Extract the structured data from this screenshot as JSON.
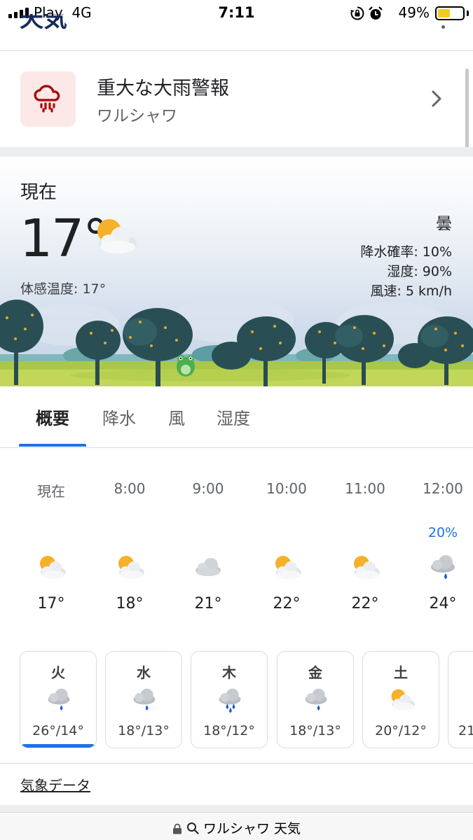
{
  "status_bar": {
    "carrier": "Play",
    "network": "4G",
    "time": "7:11",
    "battery_percent": "49%",
    "battery_level": 0.49,
    "battery_color": "#f5cc1c",
    "icons": [
      "rotation-lock-icon",
      "alarm-icon"
    ]
  },
  "header": {
    "partial_title": "天気"
  },
  "alert": {
    "title": "重大な大雨警報",
    "location": "ワルシャワ",
    "icon": "heavy-rain-icon",
    "icon_color": "#a50e0e",
    "icon_bg": "#fce8e6"
  },
  "current": {
    "label": "現在",
    "temp": "17°",
    "icon": "partly-cloudy-icon",
    "feels_like": "体感温度: 17°",
    "condition": "曇",
    "precip": "降水確率: 10%",
    "humidity": "湿度: 90%",
    "wind": "風速: 5 km/h"
  },
  "tabs": [
    {
      "label": "概要",
      "active": true
    },
    {
      "label": "降水",
      "active": false
    },
    {
      "label": "風",
      "active": false
    },
    {
      "label": "湿度",
      "active": false
    }
  ],
  "hourly": [
    {
      "time": "現在",
      "precip": "",
      "icon": "partly-cloudy-icon",
      "temp": "17°"
    },
    {
      "time": "8:00",
      "precip": "",
      "icon": "partly-cloudy-icon",
      "temp": "18°"
    },
    {
      "time": "9:00",
      "precip": "",
      "icon": "cloudy-icon",
      "temp": "21°"
    },
    {
      "time": "10:00",
      "precip": "",
      "icon": "partly-cloudy-icon",
      "temp": "22°"
    },
    {
      "time": "11:00",
      "precip": "",
      "icon": "partly-cloudy-icon",
      "temp": "22°"
    },
    {
      "time": "12:00",
      "precip": "20%",
      "icon": "rain-icon",
      "temp": "24°"
    }
  ],
  "daily": [
    {
      "day": "火",
      "icon": "rain-icon",
      "temps": "26°/14°",
      "selected": true
    },
    {
      "day": "水",
      "icon": "rain-icon",
      "temps": "18°/13°",
      "selected": false
    },
    {
      "day": "木",
      "icon": "heavy-rain-icon",
      "temps": "18°/12°",
      "selected": false
    },
    {
      "day": "金",
      "icon": "rain-icon",
      "temps": "18°/13°",
      "selected": false
    },
    {
      "day": "土",
      "icon": "partly-cloudy-icon",
      "temps": "20°/12°",
      "selected": false
    },
    {
      "day": "",
      "icon": "",
      "temps": "21",
      "selected": false
    }
  ],
  "data_link": "気象データ",
  "url_bar": {
    "text": "ワルシャワ 天気"
  },
  "colors": {
    "accent": "#1a73e8",
    "text": "#202124",
    "muted": "#5f6368"
  }
}
